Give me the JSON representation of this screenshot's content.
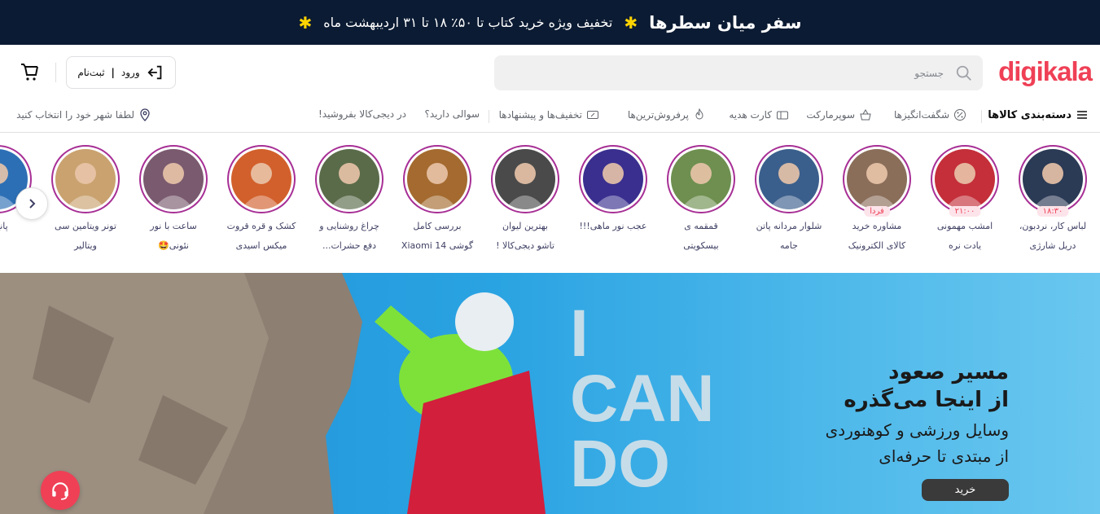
{
  "promo": {
    "brand": "سفر میان سطرها",
    "offer": "تخفیف ویژه خرید کتاب تا ۵۰٪ ۱۸ تا ۳۱ اردیبهشت ماه"
  },
  "header": {
    "logo": "digikala",
    "search_placeholder": "جستجو",
    "login_label": "ورود",
    "login_sep": "|",
    "register_label": "ثبت‌نام"
  },
  "nav": {
    "categories": "دسته‌بندی کالاها",
    "amazing": "شگفت‌انگیزها",
    "supermarket": "سوپرمارکت",
    "gift_card": "کارت هدیه",
    "bestsellers": "پرفروش‌ترین‌ها",
    "offers": "تخفیف‌ها و پیشنهادها",
    "question": "سوالی دارید؟",
    "sell": "در دیجی‌کالا بفروشید!",
    "city": "لطفا شهر خود را انتخاب کنید"
  },
  "stories": [
    {
      "line1": "لباس کار، نردبون،",
      "line2": "دریل شارژی",
      "badge": "۱۸:۳۰",
      "color": "#2b3a55"
    },
    {
      "line1": "امشب مهمونی",
      "line2": "یادت نره",
      "badge": "۲۱:۰۰",
      "color": "#c42f3a"
    },
    {
      "line1": "مشاوره خرید",
      "line2": "کالای الکترونیک",
      "badge": "فردا",
      "color": "#8a6e5a"
    },
    {
      "line1": "شلوار مردانه پاتن",
      "line2": "جامه",
      "badge": "",
      "color": "#3b5f8c"
    },
    {
      "line1": "قمقمه ی",
      "line2": "بیسکویتی",
      "badge": "",
      "color": "#6e8f4f"
    },
    {
      "line1": "عجب نور ماهی!!!",
      "line2": "",
      "badge": "",
      "color": "#3a2f8f"
    },
    {
      "line1": "بهترین لیوان",
      "line2": "تاشو دیجی‌کالا !",
      "badge": "",
      "color": "#4a4a4a"
    },
    {
      "line1": "بررسی کامل",
      "line2": "گوشی Xiaomi 14",
      "badge": "",
      "color": "#a46a2f"
    },
    {
      "line1": "چراغ روشنایی و",
      "line2": "دفع حشرات...",
      "badge": "",
      "color": "#5a6b4a"
    },
    {
      "line1": "کشک و قره قروت",
      "line2": "میکس اسیدی",
      "badge": "",
      "color": "#d2602c"
    },
    {
      "line1": "ساعت با نور",
      "line2": "نئونی🤩",
      "badge": "",
      "color": "#7a5a6f"
    },
    {
      "line1": "تونر ویتامین سی",
      "line2": "ویتالیر",
      "badge": "",
      "color": "#c9a26f"
    },
    {
      "line1": "پانچ و",
      "line2": "",
      "badge": "",
      "color": "#2d6fb5"
    }
  ],
  "hero": {
    "title_line1": "مسیر صعود",
    "title_line2": "از اینجا می‌گذره",
    "subtitle_line1": "وسایل ورزشی و کوهنوردی",
    "subtitle_line2": "از مبتدی تا حرفه‌ای",
    "buy_label": "خرید",
    "slogan_1": "I",
    "slogan_2": "CAN",
    "slogan_3": "DO"
  }
}
